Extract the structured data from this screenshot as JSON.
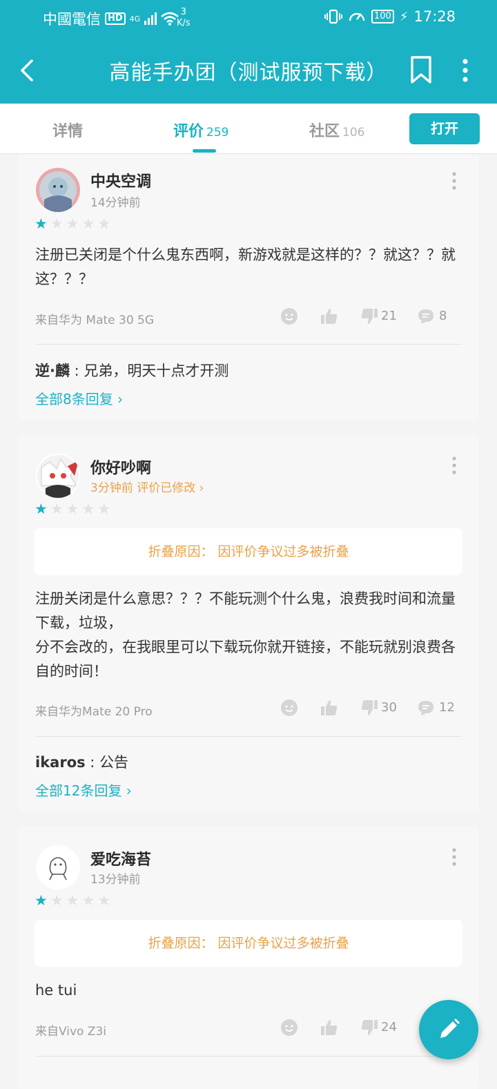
{
  "status_bar": {
    "carrier": "中國電信",
    "hd": "HD",
    "network": "4G",
    "speed_value": "3",
    "speed_unit": "K/s",
    "battery": "100",
    "time": "17:28"
  },
  "header": {
    "title": "高能手办团（测试服预下载）"
  },
  "tabs": [
    {
      "label": "详情",
      "count": ""
    },
    {
      "label": "评价",
      "count": "259"
    },
    {
      "label": "社区",
      "count": "106"
    }
  ],
  "open_button": "打开",
  "colors": {
    "accent": "#1ab2c4",
    "edited": "#e8a24a",
    "card_bg": "#f7f7f7"
  },
  "reviews": [
    {
      "username": "中央空调",
      "time": "14分钟前",
      "rating": 1,
      "folded_reason": "",
      "body": "注册已关闭是个什么鬼东西啊，新游戏就是这样的？？就这？？就这？？？",
      "device": "来自华为 Mate 30 5G",
      "dislikes": "21",
      "comments": "8",
      "reply_user": "逆·麟",
      "reply_text": "兄弟，明天十点才开测",
      "all_replies": "全部8条回复"
    },
    {
      "username": "你好吵啊",
      "time": "3分钟前 评价已修改",
      "rating": 1,
      "folded_reason": "折叠原因：  因评价争议过多被折叠",
      "body": "注册关闭是什么意思？？？不能玩测个什么鬼，浪费我时间和流量下载，垃圾，\n分不会改的，在我眼里可以下载玩你就开链接，不能玩就别浪费各自的时间！",
      "device": "来自华为Mate 20 Pro",
      "dislikes": "30",
      "comments": "12",
      "reply_user": "ikaros",
      "reply_text": "公告",
      "all_replies": "全部12条回复"
    },
    {
      "username": "爱吃海苔",
      "time": "13分钟前",
      "rating": 1,
      "folded_reason": "折叠原因：  因评价争议过多被折叠",
      "body": "he tui",
      "device": "来自Vivo Z3i",
      "dislikes": "24",
      "comments": ""
    }
  ]
}
